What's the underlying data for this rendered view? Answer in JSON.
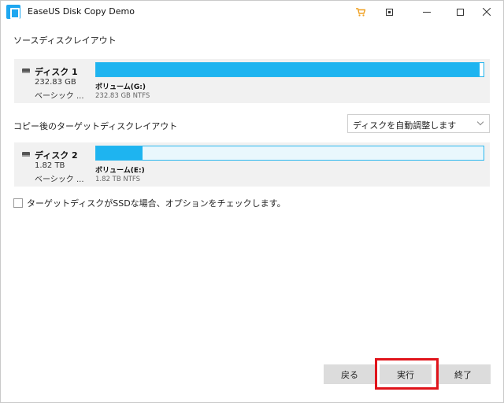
{
  "window": {
    "title": "EaseUS Disk Copy Demo",
    "accent_color": "#1eb4f0",
    "highlight_color": "#e0141b"
  },
  "icons": {
    "app": "app-icon",
    "cart": "shopping-cart-icon",
    "pin": "pin-icon",
    "minimize": "minimize-icon",
    "maximize": "maximize-icon",
    "close": "close-icon"
  },
  "source": {
    "section_label": "ソースディスクレイアウト",
    "disk": {
      "name": "ディスク 1",
      "size": "232.83 GB",
      "type": "ベーシック ...",
      "used_fraction": 0.99,
      "volume_name": "ボリューム(G:)",
      "volume_info": "232.83 GB NTFS"
    }
  },
  "target": {
    "section_label": "コピー後のターゲットディスクレイアウト",
    "layout_dropdown": {
      "selected": "ディスクを自動調整します"
    },
    "disk": {
      "name": "ディスク 2",
      "size": "1.82 TB",
      "type": "ベーシック ...",
      "used_fraction": 0.12,
      "volume_name": "ボリューム(E:)",
      "volume_info": "1.82 TB NTFS"
    }
  },
  "options": {
    "ssd_check_label": "ターゲットディスクがSSDな場合、オプションをチェックします。",
    "ssd_checked": false
  },
  "buttons": {
    "back": "戻る",
    "execute": "実行",
    "end": "終了"
  }
}
